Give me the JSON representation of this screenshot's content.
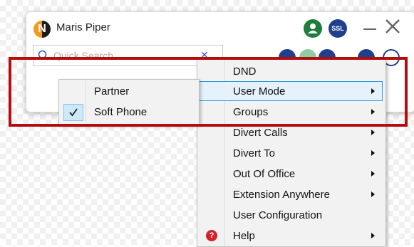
{
  "app": {
    "user_name": "Maris Piper",
    "logo_letter": "N",
    "ssl_label": "SSL"
  },
  "search": {
    "placeholder": "Quick Search"
  },
  "context_menu": {
    "items": [
      {
        "label": "DND",
        "has_submenu": false
      },
      {
        "label": "User Mode",
        "has_submenu": true,
        "selected": true
      },
      {
        "label": "Groups",
        "has_submenu": true
      },
      {
        "label": "Divert Calls",
        "has_submenu": true
      },
      {
        "label": "Divert To",
        "has_submenu": true
      },
      {
        "label": "Out Of Office",
        "has_submenu": true
      },
      {
        "label": "Extension Anywhere",
        "has_submenu": true
      },
      {
        "label": "User Configuration",
        "has_submenu": false
      },
      {
        "label": "Help",
        "has_submenu": true,
        "icon": "help-icon"
      }
    ]
  },
  "user_mode_submenu": {
    "items": [
      {
        "label": "Partner",
        "checked": false
      },
      {
        "label": "Soft Phone",
        "checked": true
      }
    ]
  },
  "colors": {
    "highlight": "#b40d0d",
    "selection": "#e5f1fb",
    "selection_border": "#26a0da",
    "brand_orange": "#f19a1f"
  }
}
